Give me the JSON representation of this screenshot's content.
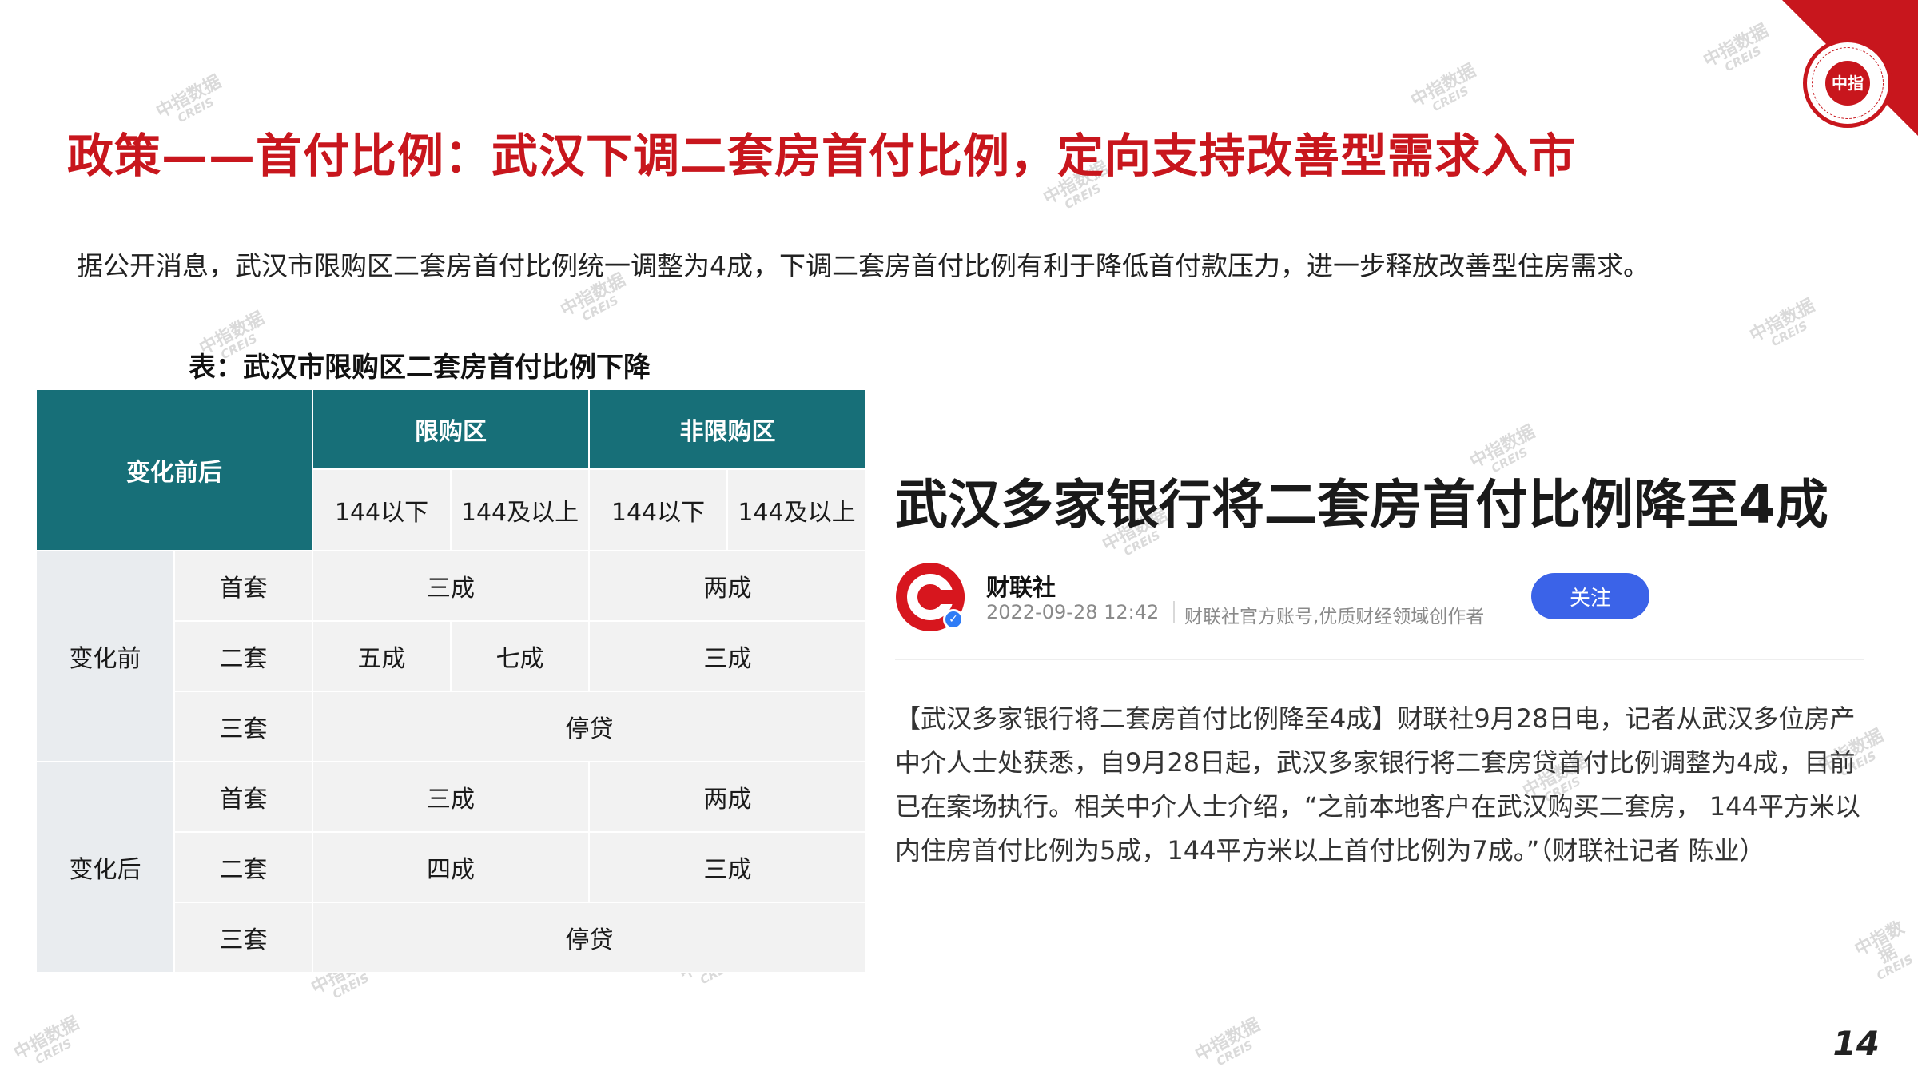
{
  "slide": {
    "title": "政策——首付比例：武汉下调二套房首付比例，定向支持改善型需求入市",
    "intro": "据公开消息，武汉市限购区二套房首付比例统一调整为4成，下调二套房首付比例有利于降低首付款压力，进一步释放改善型住房需求。",
    "page_number": "14"
  },
  "table": {
    "caption": "表：武汉市限购区二套房首付比例下降",
    "corner": "变化前后",
    "groups": [
      "限购区",
      "非限购区"
    ],
    "subheaders": [
      "144以下",
      "144及以上",
      "144以下",
      "144及以上"
    ],
    "before": {
      "label": "变化前",
      "rows": [
        {
          "label": "首套",
          "a": "三成",
          "b": "两成"
        },
        {
          "label": "二套",
          "a1": "五成",
          "a2": "七成",
          "b": "三成"
        },
        {
          "label": "三套",
          "all": "停贷"
        }
      ]
    },
    "after": {
      "label": "变化后",
      "rows": [
        {
          "label": "首套",
          "a": "三成",
          "b": "两成"
        },
        {
          "label": "二套",
          "a": "四成",
          "b": "三成"
        },
        {
          "label": "三套",
          "all": "停贷"
        }
      ]
    }
  },
  "news": {
    "headline": "武汉多家银行将二套房首付比例降至4成",
    "source": "财联社",
    "datetime": "2022-09-28 12:42",
    "source_desc": "财联社官方账号,优质财经领域创作者",
    "follow_label": "关注",
    "body": "【武汉多家银行将二套房首付比例降至4成】财联社9月28日电，记者从武汉多位房产中介人士处获悉，自9月28日起，武汉多家银行将二套房贷首付比例调整为4成，目前已在案场执行。相关中介人士介绍，“之前本地客户在武汉购买二套房， 144平方米以内住房首付比例为5成，144平方米以上首付比例为7成。”（财联社记者 陈业）"
  },
  "logo": {
    "text": "中指"
  },
  "watermark": {
    "text": "中指数据",
    "sub": "CREIS"
  },
  "colors": {
    "title_red": "#c8161d",
    "table_header_teal": "#176f78",
    "follow_blue": "#3b63e8"
  }
}
